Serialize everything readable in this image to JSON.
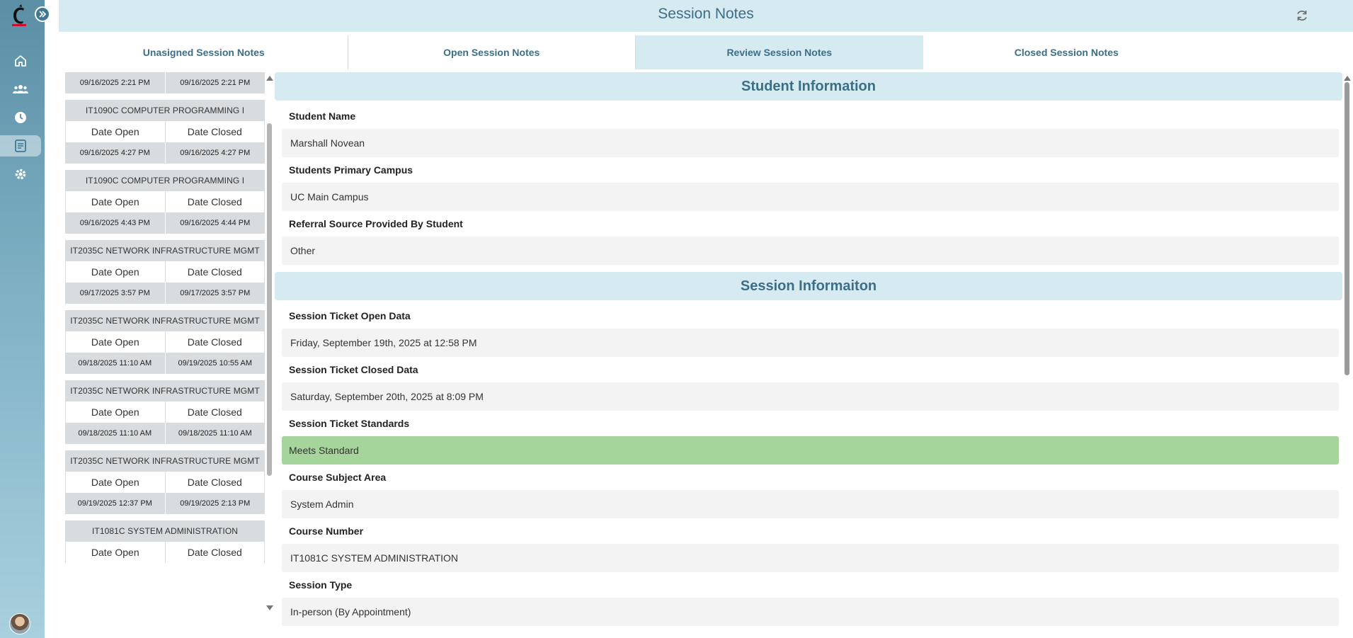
{
  "header": {
    "title": "Session Notes"
  },
  "tabs": [
    {
      "label": "Unasigned Session Notes"
    },
    {
      "label": "Open Session Notes"
    },
    {
      "label": "Review Session Notes"
    },
    {
      "label": "Closed Session Notes"
    }
  ],
  "active_tab": "Review Session Notes",
  "sessions": [
    {
      "course": "",
      "date_open_label": "",
      "date_closed_label": "",
      "date_open": "09/16/2025 2:21 PM",
      "date_closed": "09/16/2025 2:21 PM"
    },
    {
      "course": "IT1090C COMPUTER PROGRAMMING I",
      "date_open_label": "Date Open",
      "date_closed_label": "Date Closed",
      "date_open": "09/16/2025 4:27 PM",
      "date_closed": "09/16/2025 4:27 PM"
    },
    {
      "course": "IT1090C COMPUTER PROGRAMMING I",
      "date_open_label": "Date Open",
      "date_closed_label": "Date Closed",
      "date_open": "09/16/2025 4:43 PM",
      "date_closed": "09/16/2025 4:44 PM"
    },
    {
      "course": "IT2035C NETWORK INFRASTRUCTURE MGMT",
      "date_open_label": "Date Open",
      "date_closed_label": "Date Closed",
      "date_open": "09/17/2025 3:57 PM",
      "date_closed": "09/17/2025 3:57 PM"
    },
    {
      "course": "IT2035C NETWORK INFRASTRUCTURE MGMT",
      "date_open_label": "Date Open",
      "date_closed_label": "Date Closed",
      "date_open": "09/18/2025 11:10 AM",
      "date_closed": "09/19/2025 10:55 AM"
    },
    {
      "course": "IT2035C NETWORK INFRASTRUCTURE MGMT",
      "date_open_label": "Date Open",
      "date_closed_label": "Date Closed",
      "date_open": "09/18/2025 11:10 AM",
      "date_closed": "09/18/2025 11:10 AM"
    },
    {
      "course": "IT2035C NETWORK INFRASTRUCTURE MGMT",
      "date_open_label": "Date Open",
      "date_closed_label": "Date Closed",
      "date_open": "09/19/2025 12:37 PM",
      "date_closed": "09/19/2025 2:13 PM"
    },
    {
      "course": "IT1081C SYSTEM ADMINISTRATION",
      "date_open_label": "Date Open",
      "date_closed_label": "Date Closed",
      "date_open": "",
      "date_closed": ""
    }
  ],
  "student_info": {
    "heading": "Student Information",
    "fields": [
      {
        "label": "Student Name",
        "value": "Marshall Novean"
      },
      {
        "label": "Students Primary Campus",
        "value": "UC Main Campus"
      },
      {
        "label": "Referral Source Provided By Student",
        "value": "Other"
      }
    ]
  },
  "session_info": {
    "heading": "Session Informaiton",
    "fields": [
      {
        "label": "Session Ticket Open Data",
        "value": "Friday, September 19th, 2025 at 12:58 PM"
      },
      {
        "label": "Session Ticket Closed Data",
        "value": "Saturday, September 20th, 2025 at 8:09 PM"
      },
      {
        "label": "Session Ticket Standards",
        "value": "Meets Standard"
      },
      {
        "label": "Course Subject Area",
        "value": "System Admin"
      },
      {
        "label": "Course Number",
        "value": "IT1081C SYSTEM ADMINISTRATION"
      },
      {
        "label": "Session Type",
        "value": "In-person (By Appointment)"
      }
    ]
  },
  "colors": {
    "accent": "#3d6e86",
    "header_bg": "#d6eaf2",
    "standard_ok": "#a6d59b",
    "rail_top": "#5a8fa6"
  },
  "icons": [
    "university-c-logo",
    "expand-chevrons-icon",
    "home-icon",
    "users-icon",
    "clock-icon",
    "notes-icon",
    "gear-icon",
    "refresh-icon",
    "avatar"
  ]
}
